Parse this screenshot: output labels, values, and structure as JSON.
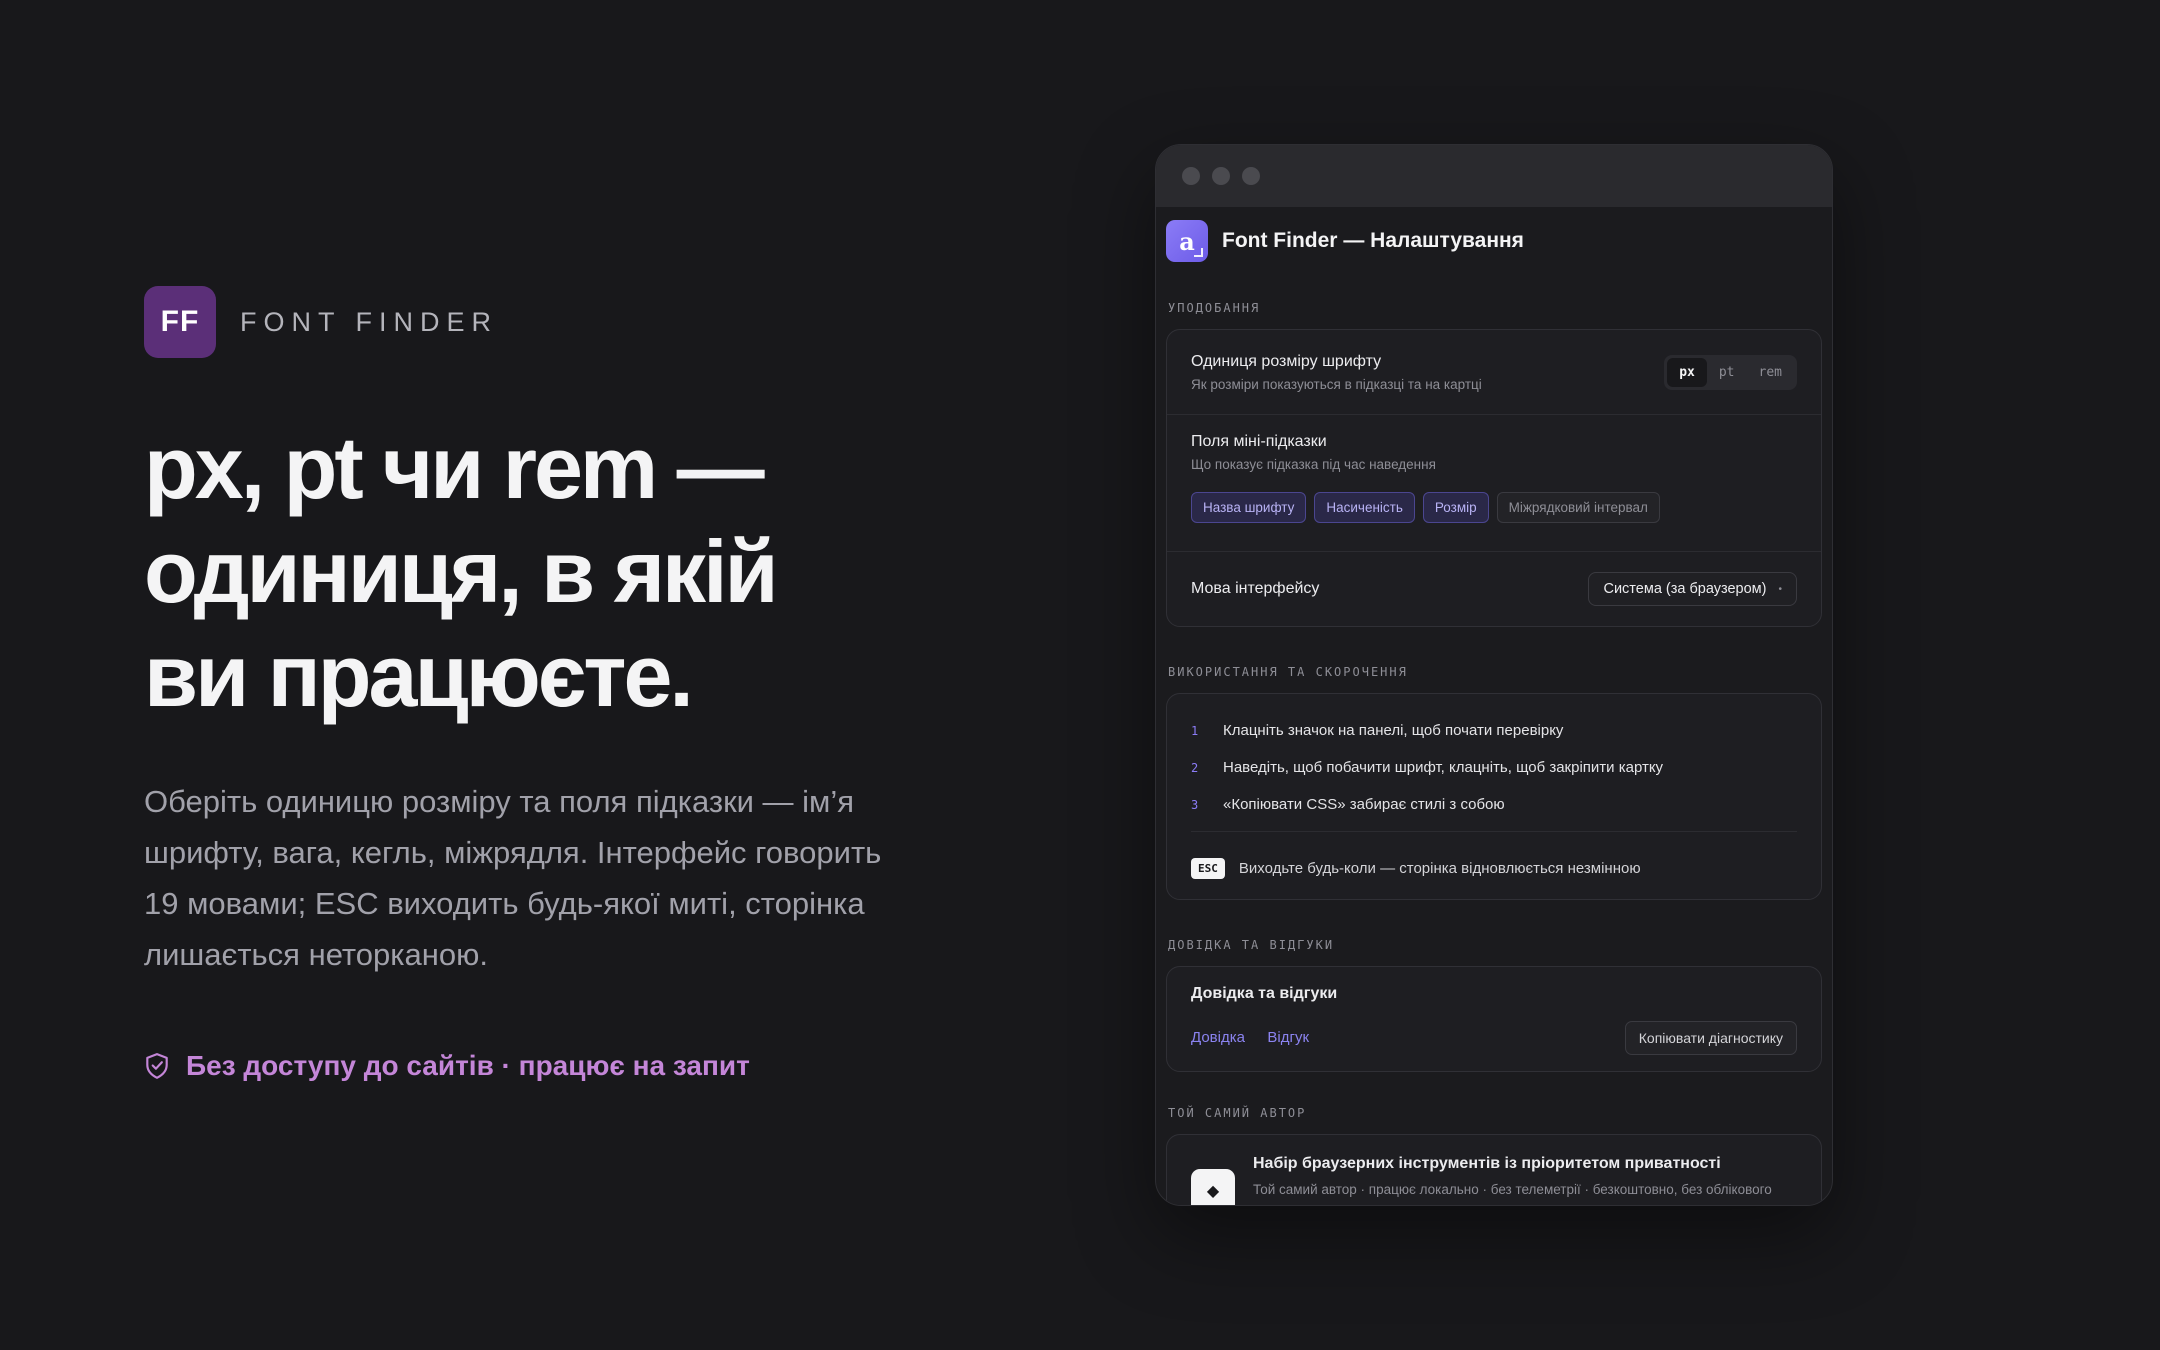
{
  "brand": {
    "mark": "FF",
    "name": "FONT FINDER"
  },
  "hero": {
    "headline_1": "px, pt чи rem —",
    "headline_2": "одиниця, в якій",
    "headline_3": "ви працюєте.",
    "lead": "Оберіть одиницю розміру та поля підказки — ім’я шрифту, вага, кегль, міжрядля. Інтерфейс говорить 19 мовами; ESC виходить будь-якої миті, сторінка лишається неторканою.",
    "trust": "Без доступу до сайтів · працює на запит"
  },
  "window": {
    "app_title": "Font Finder — Налаштування",
    "app_icon_letter": "a",
    "sections": {
      "prefs": "УПОДОБАННЯ",
      "usage": "ВИКОРИСТАННЯ ТА СКОРОЧЕННЯ",
      "help": "ДОВІДКА ТА ВІДГУКИ",
      "author": "ТОЙ САМИЙ АВТОР"
    },
    "unit": {
      "title": "Одиниця розміру шрифту",
      "sub": "Як розміри показуються в підказці та на картці",
      "options": [
        "px",
        "pt",
        "rem"
      ],
      "selected": "px"
    },
    "fields": {
      "title": "Поля міні-підказки",
      "sub": "Що показує підказка під час наведення",
      "chips": [
        {
          "label": "Назва шрифту",
          "on": true
        },
        {
          "label": "Насиченість",
          "on": true
        },
        {
          "label": "Розмір",
          "on": true
        },
        {
          "label": "Міжрядковий інтервал",
          "on": false
        }
      ]
    },
    "language": {
      "title": "Мова інтерфейсу",
      "value": "Система (за браузером)"
    },
    "steps": [
      {
        "n": "1",
        "text": "Клацніть значок на панелі, щоб почати перевірку"
      },
      {
        "n": "2",
        "text": "Наведіть, щоб побачити шрифт, клацніть, щоб закріпити картку"
      },
      {
        "n": "3",
        "text": "«Копіювати CSS» забирає стилі з собою"
      }
    ],
    "esc": {
      "key": "ESC",
      "text": "Виходьте будь-коли — сторінка відновлюється незмінною"
    },
    "help": {
      "title": "Довідка та відгуки",
      "link_help": "Довідка",
      "link_feedback": "Відгук",
      "copy_button": "Копіювати діагностику"
    },
    "promo": {
      "title": "Набір браузерних інструментів із пріоритетом приватності",
      "sub": "Той самий автор · працює локально · без телеметрії · безкоштовно, без облікового запису"
    }
  },
  "colors": {
    "background": "#18181b",
    "brand_mark": "#5b2f78",
    "accent": "#8b7cf6",
    "trust": "#c486d8"
  }
}
